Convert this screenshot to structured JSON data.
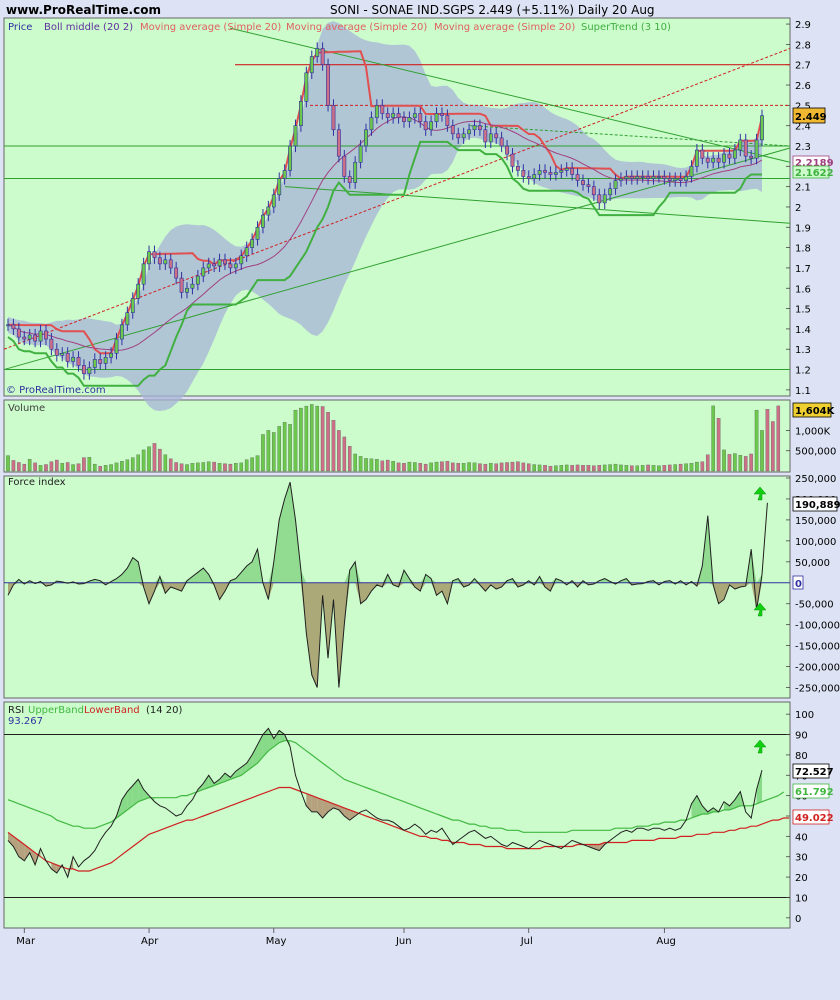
{
  "header": {
    "site": "www.ProRealTime.com",
    "title": "SONI - SONAE IND.SGPS   2.449 (+5.11%)   Daily  20 Aug",
    "copyright": "© ProRealTime.com"
  },
  "colors": {
    "background": "#dde3f4",
    "panel": "#ccfccc",
    "up": "#6cc84c",
    "down": "#cc7088",
    "band": "#a8b4d8",
    "ma": "#e05050",
    "supertrend": "#40b040",
    "boll_mid": "#a04080",
    "trend": "#30a030",
    "resistance": "#d02020",
    "rsi": "#202020",
    "upper_band": "#40b840",
    "lower_band": "#d02020",
    "force": "#202020"
  },
  "price_panel": {
    "legend": [
      "Price",
      "Boll middle (20 2)",
      "Moving average (Simple 20)",
      "Moving average (Simple 20)",
      "Moving average (Simple 20)",
      "SuperTrend (3 10)"
    ],
    "badges": {
      "last": "2.449",
      "boll": "2.2189",
      "supertrend": "2.1622"
    }
  },
  "volume_panel": {
    "label": "Volume",
    "badge": "1,604K"
  },
  "force_panel": {
    "label": "Force index",
    "badges": {
      "last": "190,889",
      "zero": "0"
    }
  },
  "rsi_panel": {
    "label": "RSI",
    "legend_upper": "UpperBand",
    "legend_lower": "LowerBand",
    "params": "(14 20)",
    "value_label": "93.267",
    "badges": {
      "rsi": "72.527",
      "upper": "61.792",
      "lower": "49.022"
    }
  },
  "x_axis": {
    "months": [
      "Mar",
      "Apr",
      "May",
      "Jun",
      "Jul",
      "Aug"
    ]
  },
  "chart_data": [
    {
      "type": "candlestick",
      "ylim": [
        1.1,
        2.9
      ],
      "yticks": [
        "1.1",
        "1.2",
        "1.3",
        "1.4",
        "1.5",
        "1.6",
        "1.7",
        "1.8",
        "1.9",
        "2",
        "2.1",
        "2.2",
        "2.3",
        "2.4",
        "2.5",
        "2.6",
        "2.7",
        "2.8",
        "2.9"
      ],
      "close": [
        1.42,
        1.4,
        1.36,
        1.35,
        1.37,
        1.34,
        1.39,
        1.35,
        1.3,
        1.27,
        1.28,
        1.24,
        1.26,
        1.22,
        1.18,
        1.21,
        1.25,
        1.23,
        1.26,
        1.28,
        1.35,
        1.42,
        1.48,
        1.55,
        1.62,
        1.72,
        1.78,
        1.75,
        1.72,
        1.74,
        1.7,
        1.65,
        1.58,
        1.6,
        1.62,
        1.66,
        1.7,
        1.72,
        1.71,
        1.74,
        1.72,
        1.7,
        1.72,
        1.76,
        1.8,
        1.84,
        1.9,
        1.96,
        2.0,
        2.06,
        2.14,
        2.18,
        2.3,
        2.4,
        2.52,
        2.66,
        2.74,
        2.78,
        2.7,
        2.5,
        2.38,
        2.25,
        2.15,
        2.12,
        2.22,
        2.3,
        2.38,
        2.44,
        2.5,
        2.46,
        2.44,
        2.46,
        2.44,
        2.42,
        2.44,
        2.46,
        2.42,
        2.38,
        2.42,
        2.46,
        2.45,
        2.4,
        2.36,
        2.34,
        2.36,
        2.38,
        2.4,
        2.38,
        2.32,
        2.36,
        2.34,
        2.3,
        2.26,
        2.2,
        2.18,
        2.15,
        2.14,
        2.16,
        2.18,
        2.17,
        2.16,
        2.17,
        2.18,
        2.19,
        2.16,
        2.13,
        2.11,
        2.1,
        2.06,
        2.02,
        2.06,
        2.09,
        2.13,
        2.14,
        2.15,
        2.14,
        2.15,
        2.15,
        2.14,
        2.15,
        2.15,
        2.14,
        2.13,
        2.14,
        2.13,
        2.15,
        2.2,
        2.28,
        2.24,
        2.22,
        2.24,
        2.22,
        2.26,
        2.24,
        2.28,
        2.33,
        2.25,
        2.24,
        2.33,
        2.449
      ],
      "volume_k": [
        380,
        260,
        210,
        170,
        290,
        200,
        140,
        160,
        230,
        270,
        190,
        210,
        160,
        180,
        330,
        340,
        170,
        120,
        140,
        160,
        200,
        240,
        280,
        330,
        400,
        520,
        600,
        680,
        540,
        400,
        300,
        210,
        180,
        160,
        190,
        200,
        210,
        230,
        220,
        190,
        180,
        170,
        190,
        200,
        280,
        330,
        380,
        900,
        1000,
        950,
        1100,
        1200,
        1150,
        1500,
        1550,
        1600,
        1640,
        1600,
        1590,
        1450,
        1250,
        1000,
        840,
        610,
        420,
        360,
        310,
        300,
        290,
        250,
        270,
        240,
        200,
        190,
        220,
        210,
        190,
        170,
        200,
        220,
        230,
        240,
        200,
        190,
        190,
        210,
        200,
        180,
        170,
        190,
        180,
        200,
        210,
        220,
        230,
        200,
        180,
        160,
        150,
        140,
        120,
        130,
        140,
        150,
        140,
        150,
        140,
        140,
        130,
        140,
        150,
        160,
        170,
        150,
        140,
        130,
        130,
        140,
        150,
        140,
        130,
        140,
        150,
        160,
        170,
        180,
        190,
        220,
        230,
        400,
        1604,
        1300,
        520,
        410,
        430,
        390,
        360,
        420,
        1500,
        1000,
        1520,
        1220,
        1604
      ],
      "force": [
        -30000,
        -5000,
        8000,
        -3000,
        5000,
        -2000,
        3000,
        -8000,
        -5000,
        4000,
        2000,
        -1000,
        2000,
        -3000,
        -2000,
        4000,
        8000,
        5000,
        -5000,
        3000,
        10000,
        20000,
        35000,
        60000,
        50000,
        -10000,
        -50000,
        -20000,
        15000,
        -25000,
        -10000,
        -15000,
        -20000,
        5000,
        15000,
        25000,
        35000,
        20000,
        -5000,
        -40000,
        -20000,
        5000,
        10000,
        25000,
        40000,
        50000,
        80000,
        0,
        -40000,
        50000,
        150000,
        200000,
        240000,
        150000,
        30000,
        -120000,
        -220000,
        -250000,
        -30000,
        -180000,
        -40000,
        -250000,
        -100000,
        30000,
        50000,
        -50000,
        -40000,
        -20000,
        -5000,
        -10000,
        20000,
        -5000,
        -10000,
        30000,
        10000,
        -10000,
        -20000,
        20000,
        10000,
        -30000,
        -20000,
        -50000,
        5000,
        10000,
        -10000,
        -5000,
        10000,
        -5000,
        -20000,
        -5000,
        -15000,
        -10000,
        5000,
        10000,
        -10000,
        -5000,
        5000,
        -5000,
        15000,
        -10000,
        -20000,
        10000,
        5000,
        -5000,
        5000,
        -10000,
        5000,
        -5000,
        -3000,
        5000,
        10000,
        3000,
        -3000,
        5000,
        10000,
        -5000,
        -3000,
        -2000,
        3000,
        5000,
        -5000,
        3000,
        5000,
        -3000,
        5000,
        -5000,
        3000,
        -8000,
        40000,
        160000,
        -5000,
        -50000,
        -40000,
        -5000,
        -15000,
        -10000,
        -8000,
        80000,
        -65000,
        20000,
        190889
      ],
      "rsi": [
        38,
        35,
        30,
        28,
        32,
        26,
        34,
        28,
        24,
        22,
        26,
        20,
        30,
        25,
        28,
        30,
        33,
        38,
        42,
        45,
        50,
        58,
        62,
        65,
        68,
        63,
        60,
        57,
        55,
        54,
        52,
        50,
        51,
        55,
        58,
        63,
        66,
        70,
        66,
        68,
        71,
        69,
        72,
        74,
        76,
        80,
        85,
        90,
        93,
        88,
        92,
        90,
        84,
        70,
        62,
        55,
        52,
        52,
        49,
        52,
        54,
        53,
        50,
        48,
        50,
        52,
        53,
        51,
        49,
        48,
        48,
        47,
        45,
        43,
        44,
        46,
        44,
        41,
        43,
        42,
        44,
        40,
        36,
        38,
        40,
        42,
        43,
        41,
        39,
        40,
        38,
        36,
        35,
        37,
        36,
        35,
        34,
        36,
        38,
        37,
        36,
        35,
        34,
        36,
        38,
        37,
        36,
        35,
        34,
        33,
        36,
        38,
        40,
        42,
        43,
        42,
        44,
        44,
        43,
        44,
        44,
        43,
        44,
        43,
        44,
        48,
        56,
        60,
        55,
        52,
        54,
        52,
        57,
        55,
        58,
        62,
        52,
        49,
        63,
        72.527
      ],
      "upper_band": [
        58,
        57,
        56,
        55,
        54,
        53,
        52,
        51,
        50,
        48,
        47,
        46,
        45,
        45,
        44,
        44,
        44,
        45,
        46,
        47,
        49,
        51,
        53,
        55,
        57,
        58,
        59,
        59,
        59,
        59,
        59,
        59,
        60,
        60,
        61,
        62,
        63,
        64,
        65,
        66,
        67,
        68,
        69,
        70,
        72,
        74,
        76,
        79,
        82,
        84,
        86,
        87,
        87,
        86,
        84,
        82,
        80,
        78,
        76,
        74,
        72,
        70,
        68,
        67,
        66,
        65,
        64,
        63,
        62,
        61,
        60,
        59,
        58,
        57,
        56,
        55,
        54,
        53,
        52,
        51,
        50,
        49,
        48,
        48,
        47,
        46,
        46,
        45,
        45,
        44,
        44,
        44,
        43,
        43,
        43,
        42,
        42,
        42,
        42,
        42,
        42,
        42,
        42,
        42,
        43,
        43,
        43,
        43,
        43,
        43,
        43,
        43,
        44,
        44,
        44,
        44,
        45,
        45,
        45,
        46,
        46,
        47,
        47,
        47,
        48,
        48,
        49,
        50,
        51,
        51,
        52,
        52,
        53,
        53,
        54,
        55,
        55,
        55,
        56,
        57,
        58,
        59,
        60,
        61.792
      ],
      "lower_band": [
        42,
        40,
        38,
        36,
        34,
        32,
        30,
        28,
        27,
        26,
        25,
        24,
        24,
        23,
        23,
        23,
        24,
        25,
        26,
        27,
        29,
        31,
        33,
        35,
        37,
        39,
        41,
        42,
        43,
        44,
        45,
        46,
        47,
        48,
        48,
        49,
        50,
        51,
        52,
        53,
        54,
        55,
        56,
        57,
        58,
        59,
        60,
        61,
        62,
        63,
        64,
        64,
        64,
        63,
        62,
        61,
        60,
        59,
        58,
        57,
        56,
        55,
        54,
        53,
        52,
        51,
        50,
        49,
        48,
        47,
        46,
        45,
        44,
        43,
        42,
        41,
        40,
        40,
        39,
        39,
        38,
        38,
        37,
        37,
        37,
        36,
        36,
        36,
        35,
        35,
        35,
        35,
        34,
        34,
        34,
        34,
        34,
        34,
        34,
        35,
        35,
        35,
        35,
        35,
        35,
        36,
        36,
        36,
        36,
        36,
        37,
        37,
        37,
        37,
        37,
        38,
        38,
        38,
        38,
        38,
        39,
        39,
        39,
        39,
        40,
        40,
        40,
        41,
        41,
        41,
        42,
        42,
        42,
        43,
        43,
        44,
        44,
        45,
        45,
        46,
        47,
        48,
        48,
        49,
        49.022
      ]
    }
  ]
}
